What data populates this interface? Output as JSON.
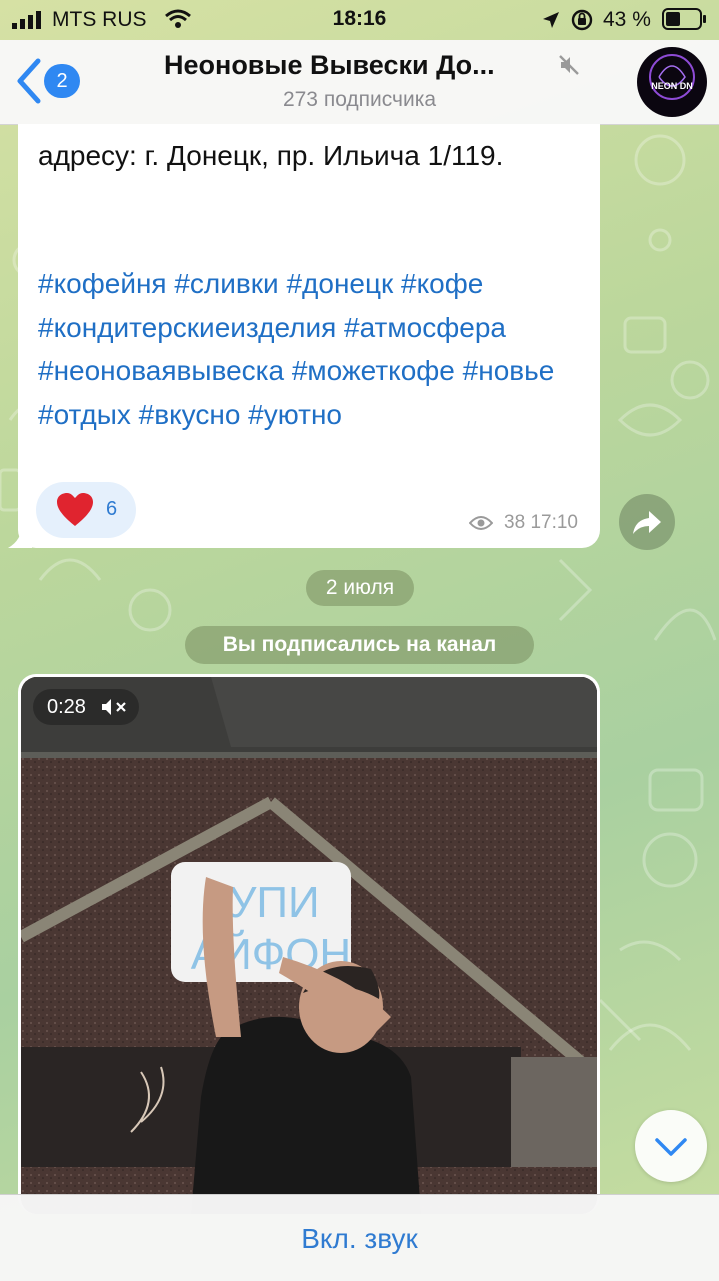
{
  "status_bar": {
    "carrier": "MTS RUS",
    "time": "18:16",
    "battery": "43 %",
    "battery_level": 0.43
  },
  "header": {
    "back_count": "2",
    "title": "Неоновые Вывески До...",
    "subscribers": "273 подписчика",
    "avatar_logo_text": "NEON DN"
  },
  "message1": {
    "address_text": "адресу:  г. Донецк,  пр. Ильича 1/119.",
    "hashtags": "#кофейня #сливки #донецк #кофе #кондитерскиеизделия #атмосфера #неоноваявывеска #можеткофе #новье #отдых #вкусно #уютно",
    "reaction_count": "6",
    "views": "38",
    "time": "17:10"
  },
  "service": {
    "date": "2 июля",
    "subscribed": "Вы подписались на канал"
  },
  "video": {
    "duration": "0:28",
    "sign_text": "КУПИ АЙФОН"
  },
  "bottom": {
    "unmute_label": "Вкл. звук"
  },
  "colors": {
    "accent": "#2f88f2",
    "link": "#1f6fc5",
    "reaction_bg": "#e5f0fc",
    "heart": "#e0242f"
  },
  "icons": {
    "back": "chevron-left-icon",
    "mute": "speaker-muted-icon",
    "reaction": "heart-icon",
    "views": "eye-icon",
    "share": "share-arrow-icon",
    "video_muted": "speaker-off-icon",
    "scroll": "chevron-down-icon"
  }
}
